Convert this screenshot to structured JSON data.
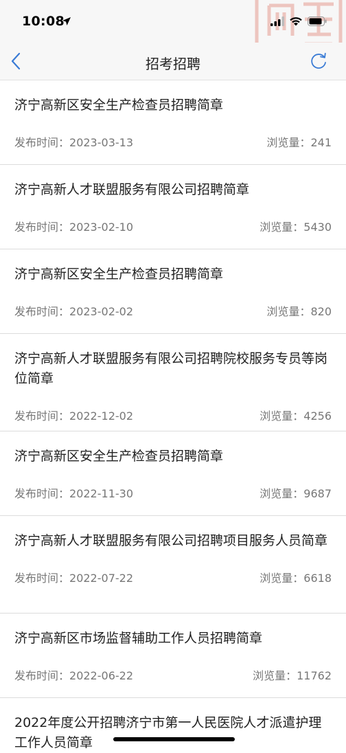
{
  "status_bar": {
    "time": "10:08"
  },
  "navbar": {
    "title": "招考招聘",
    "back_icon": "chevron-left-icon",
    "refresh_icon": "refresh-icon"
  },
  "labels": {
    "date_prefix": "发布时间：",
    "views_prefix": "浏览量："
  },
  "items": [
    {
      "title": "济宁高新区安全生产检查员招聘简章",
      "date": "2023-03-13",
      "views": "241"
    },
    {
      "title": "济宁高新人才联盟服务有限公司招聘简章",
      "date": "2023-02-10",
      "views": "5430"
    },
    {
      "title": "济宁高新区安全生产检查员招聘简章",
      "date": "2023-02-02",
      "views": "820"
    },
    {
      "title": "济宁高新人才联盟服务有限公司招聘院校服务专员等岗位简章",
      "date": "2022-12-02",
      "views": "4256"
    },
    {
      "title": "济宁高新区安全生产检查员招聘简章",
      "date": "2022-11-30",
      "views": "9687"
    },
    {
      "title": "济宁高新人才联盟服务有限公司招聘项目服务人员简章",
      "date": "2022-07-22",
      "views": "6618"
    },
    {
      "title": "济宁高新区市场监督辅助工作人员招聘简章",
      "date": "2022-06-22",
      "views": "11762"
    },
    {
      "title": "2022年度公开招聘济宁市第一人民医院人才派遣护理工作人员简章",
      "date": "",
      "views": ""
    }
  ],
  "colors": {
    "accent": "#3a7bd5",
    "stamp": "#e8b8b0"
  }
}
